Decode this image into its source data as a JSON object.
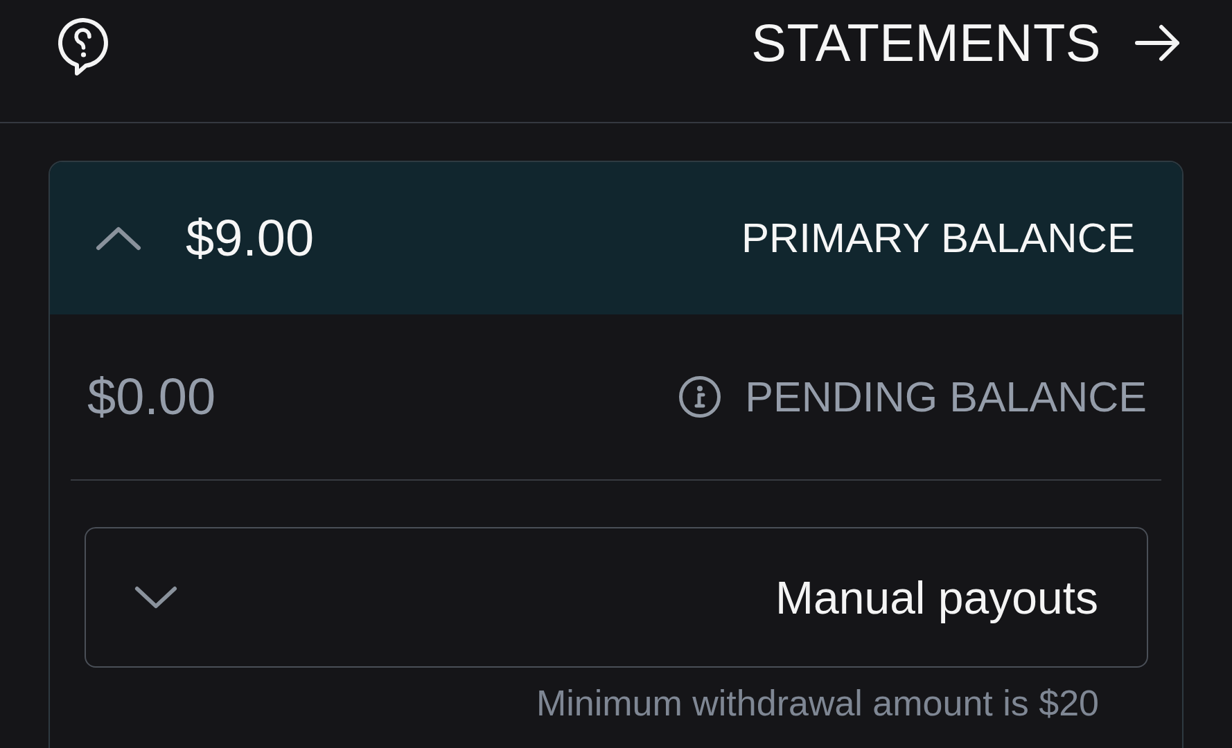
{
  "header": {
    "title": "STATEMENTS"
  },
  "primary_balance": {
    "label": "PRIMARY BALANCE",
    "amount": "$9.00",
    "expanded": true
  },
  "pending_balance": {
    "label": "PENDING BALANCE",
    "amount": "$0.00"
  },
  "payout_select": {
    "value": "Manual payouts"
  },
  "hint": "Minimum withdrawal amount is $20"
}
